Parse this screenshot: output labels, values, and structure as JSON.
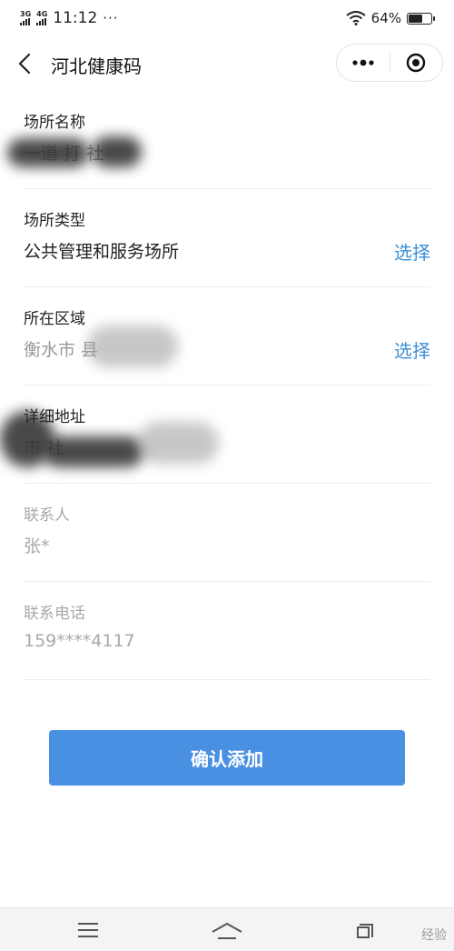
{
  "status_bar": {
    "net1": "3G",
    "net2": "4G",
    "time": "11:12",
    "dots": "···",
    "battery_text": "64%",
    "battery_level": 0.64
  },
  "nav": {
    "title": "河北健康码"
  },
  "form": {
    "fields": [
      {
        "label": "场所名称",
        "value": "一道 打 社"
      },
      {
        "label": "场所类型",
        "value": "公共管理和服务场所",
        "action": "选择"
      },
      {
        "label": "所在区域",
        "value": "衡水市 县",
        "action": "选择"
      },
      {
        "label": "详细地址",
        "value": "市 社"
      },
      {
        "label": "联系人",
        "value": "张*"
      },
      {
        "label": "联系电话",
        "value": "159****4117"
      }
    ]
  },
  "confirm_button": "确认添加",
  "watermark": "经验"
}
